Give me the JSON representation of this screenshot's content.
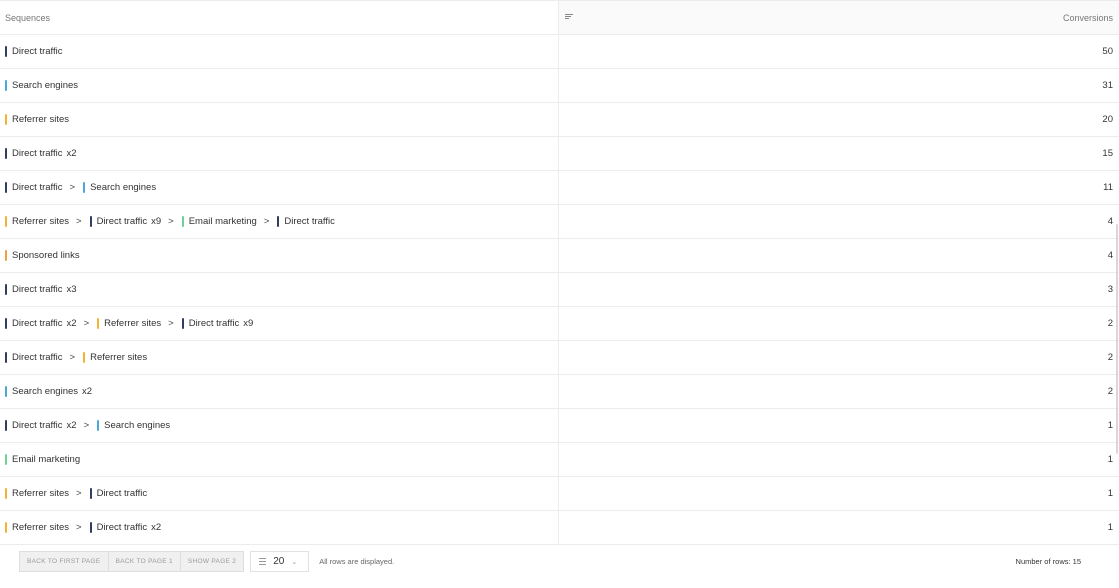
{
  "colors": {
    "direct": "#2f3e5c",
    "search": "#4aa8d8",
    "referrer": "#f2b233",
    "email": "#6fd19a",
    "sponsored": "#f0a03c"
  },
  "header": {
    "sequences_label": "Sequences",
    "conversions_label": "Conversions",
    "sort_icon": "sort-icon"
  },
  "rows": [
    {
      "steps": [
        {
          "label": "Direct traffic",
          "channel": "direct",
          "mult": ""
        }
      ],
      "conversions": "50"
    },
    {
      "steps": [
        {
          "label": "Search engines",
          "channel": "search",
          "mult": ""
        }
      ],
      "conversions": "31"
    },
    {
      "steps": [
        {
          "label": "Referrer sites",
          "channel": "referrer",
          "mult": ""
        }
      ],
      "conversions": "20"
    },
    {
      "steps": [
        {
          "label": "Direct traffic",
          "channel": "direct",
          "mult": "x2"
        }
      ],
      "conversions": "15"
    },
    {
      "steps": [
        {
          "label": "Direct traffic",
          "channel": "direct",
          "mult": ""
        },
        {
          "label": "Search engines",
          "channel": "search",
          "mult": ""
        }
      ],
      "conversions": "11"
    },
    {
      "steps": [
        {
          "label": "Referrer sites",
          "channel": "referrer",
          "mult": ""
        },
        {
          "label": "Direct traffic",
          "channel": "direct",
          "mult": "x9"
        },
        {
          "label": "Email marketing",
          "channel": "email",
          "mult": ""
        },
        {
          "label": "Direct traffic",
          "channel": "direct",
          "mult": ""
        }
      ],
      "conversions": "4"
    },
    {
      "steps": [
        {
          "label": "Sponsored links",
          "channel": "sponsored",
          "mult": ""
        }
      ],
      "conversions": "4"
    },
    {
      "steps": [
        {
          "label": "Direct traffic",
          "channel": "direct",
          "mult": "x3"
        }
      ],
      "conversions": "3"
    },
    {
      "steps": [
        {
          "label": "Direct traffic",
          "channel": "direct",
          "mult": "x2"
        },
        {
          "label": "Referrer sites",
          "channel": "referrer",
          "mult": ""
        },
        {
          "label": "Direct traffic",
          "channel": "direct",
          "mult": "x9"
        }
      ],
      "conversions": "2"
    },
    {
      "steps": [
        {
          "label": "Direct traffic",
          "channel": "direct",
          "mult": ""
        },
        {
          "label": "Referrer sites",
          "channel": "referrer",
          "mult": ""
        }
      ],
      "conversions": "2"
    },
    {
      "steps": [
        {
          "label": "Search engines",
          "channel": "search",
          "mult": "x2"
        }
      ],
      "conversions": "2"
    },
    {
      "steps": [
        {
          "label": "Direct traffic",
          "channel": "direct",
          "mult": "x2"
        },
        {
          "label": "Search engines",
          "channel": "search",
          "mult": ""
        }
      ],
      "conversions": "1"
    },
    {
      "steps": [
        {
          "label": "Email marketing",
          "channel": "email",
          "mult": ""
        }
      ],
      "conversions": "1"
    },
    {
      "steps": [
        {
          "label": "Referrer sites",
          "channel": "referrer",
          "mult": ""
        },
        {
          "label": "Direct traffic",
          "channel": "direct",
          "mult": ""
        }
      ],
      "conversions": "1"
    },
    {
      "steps": [
        {
          "label": "Referrer sites",
          "channel": "referrer",
          "mult": ""
        },
        {
          "label": "Direct traffic",
          "channel": "direct",
          "mult": "x2"
        }
      ],
      "conversions": "1"
    }
  ],
  "arrow": ">",
  "footer": {
    "back_first": "BACK TO FIRST PAGE",
    "back_page": "BACK TO PAGE 1",
    "show_page": "SHOW PAGE 2",
    "rows_per_page": "20",
    "rows_note": "All rows are displayed.",
    "row_count": "Number of rows: 15"
  }
}
